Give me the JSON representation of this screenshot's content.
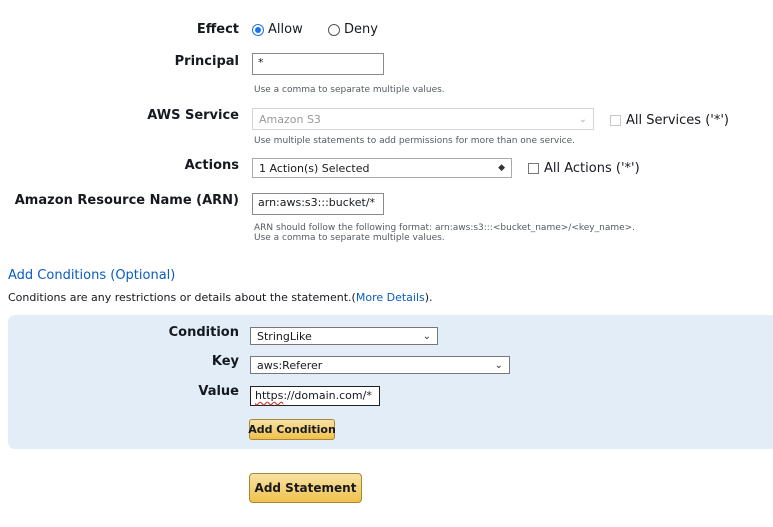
{
  "effect": {
    "label": "Effect",
    "options": [
      {
        "label": "Allow",
        "selected": true
      },
      {
        "label": "Deny",
        "selected": false
      }
    ]
  },
  "principal": {
    "label": "Principal",
    "value": "*",
    "hint": "Use a comma to separate multiple values."
  },
  "aws_service": {
    "label": "AWS Service",
    "value": "Amazon S3",
    "hint": "Use multiple statements to add permissions for more than one service.",
    "all_label": "All Services ('*')"
  },
  "actions": {
    "label": "Actions",
    "value": "1 Action(s) Selected",
    "all_label": "All Actions ('*')"
  },
  "arn": {
    "label": "Amazon Resource Name (ARN)",
    "value": "arn:aws:s3:::bucket/*",
    "hint_line1": "ARN should follow the following format: arn:aws:s3:::<bucket_name>/<key_name>.",
    "hint_line2": "Use a comma to separate multiple values."
  },
  "conditions": {
    "title": "Add Conditions (Optional)",
    "desc": "Conditions are any restrictions or details about the statement.(",
    "link": "More Details",
    "desc_end": ").",
    "condition_label": "Condition",
    "condition_value": "StringLike",
    "key_label": "Key",
    "key_value": "aws:Referer",
    "value_label": "Value",
    "value_prefix": "https",
    "value_rest": "://domain.com/*",
    "add_condition_button": "Add Condition"
  },
  "add_statement_button": "Add Statement",
  "colors": {
    "link": "#0a5cbf",
    "panel": "#e2edf7",
    "button": "#f0c14b",
    "radio": "#1a73e8"
  }
}
